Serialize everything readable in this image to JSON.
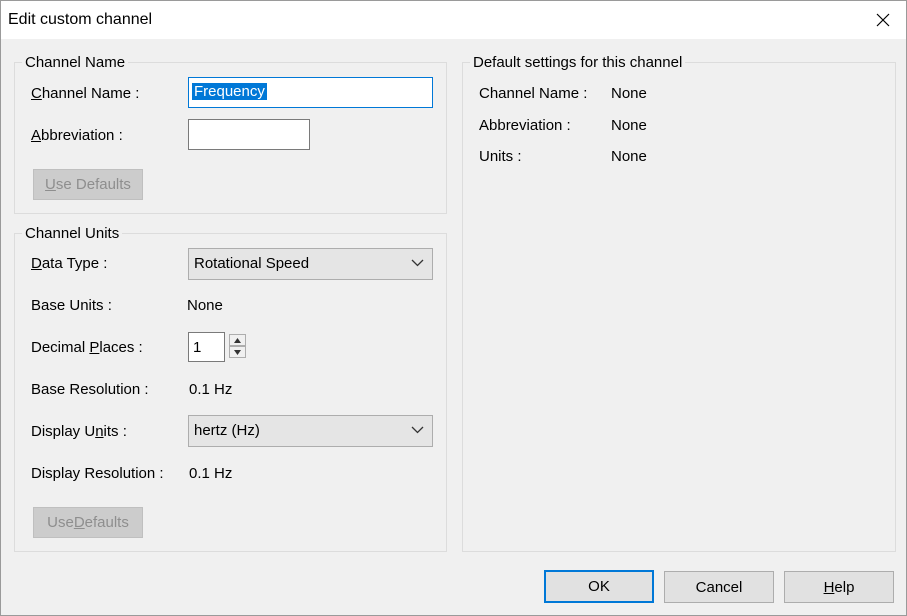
{
  "window": {
    "title": "Edit custom channel"
  },
  "channel_name_group": {
    "legend": "Channel Name",
    "channel_name_label_pre": "",
    "channel_name_label_u": "C",
    "channel_name_label_post": "hannel Name :",
    "channel_name_value": "Frequency",
    "abbreviation_label_pre": "",
    "abbreviation_label_u": "A",
    "abbreviation_label_post": "bbreviation :",
    "abbreviation_value": "",
    "use_defaults_pre": "",
    "use_defaults_u": "U",
    "use_defaults_post": "se Defaults"
  },
  "channel_units_group": {
    "legend": "Channel Units",
    "data_type_label_pre": "",
    "data_type_label_u": "D",
    "data_type_label_post": "ata Type :",
    "data_type_value": "Rotational Speed",
    "base_units_label": "Base Units :",
    "base_units_value": "None",
    "decimal_places_label_pre": "Decimal ",
    "decimal_places_label_u": "P",
    "decimal_places_label_post": "laces :",
    "decimal_places_value": "1",
    "base_resolution_label": "Base Resolution :",
    "base_resolution_value": "0.1 Hz",
    "display_units_label_pre": "Display U",
    "display_units_label_u": "n",
    "display_units_label_post": "its :",
    "display_units_value": "hertz (Hz)",
    "display_resolution_label": "Display Resolution :",
    "display_resolution_value": "0.1 Hz",
    "use_defaults_pre": "Use ",
    "use_defaults_u": "D",
    "use_defaults_post": "efaults"
  },
  "defaults_group": {
    "legend": "Default settings for this channel",
    "channel_name_label": "Channel Name :",
    "channel_name_value": "None",
    "abbreviation_label": "Abbreviation :",
    "abbreviation_value": "None",
    "units_label": "Units :",
    "units_value": "None"
  },
  "buttons": {
    "ok": "OK",
    "cancel": "Cancel",
    "help_pre": "",
    "help_u": "H",
    "help_post": "elp"
  },
  "icons": {
    "close": "close-icon",
    "dropdown": "chevron-down-icon",
    "spin_up": "spin-up-icon",
    "spin_down": "spin-down-icon"
  }
}
